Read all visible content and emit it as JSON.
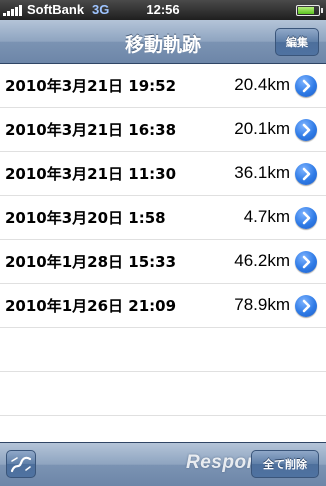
{
  "status_bar": {
    "carrier": "SoftBank",
    "network": "3G",
    "time": "12:56",
    "battery_level": 0.9,
    "signal_icon": "signal-bars-icon",
    "battery_icon": "battery-icon"
  },
  "nav_bar": {
    "title": "移動軌跡",
    "edit_label": "編集"
  },
  "tracks": [
    {
      "date": "2010年3月21日 19:52",
      "distance": "20.4km"
    },
    {
      "date": "2010年3月21日 16:38",
      "distance": "20.1km"
    },
    {
      "date": "2010年3月21日 11:30",
      "distance": "36.1km"
    },
    {
      "date": "2010年3月20日 1:58",
      "distance": "4.7km"
    },
    {
      "date": "2010年1月28日 15:33",
      "distance": "46.2km"
    },
    {
      "date": "2010年1月26日 21:09",
      "distance": "78.9km"
    }
  ],
  "toolbar": {
    "route_icon": "route-icon",
    "delete_all_label": "全て削除",
    "watermark": "Response."
  },
  "colors": {
    "nav_bar": "#8ea4c0",
    "disclosure_button": "#2f7be6",
    "network_indicator": "#9ec4ff"
  }
}
